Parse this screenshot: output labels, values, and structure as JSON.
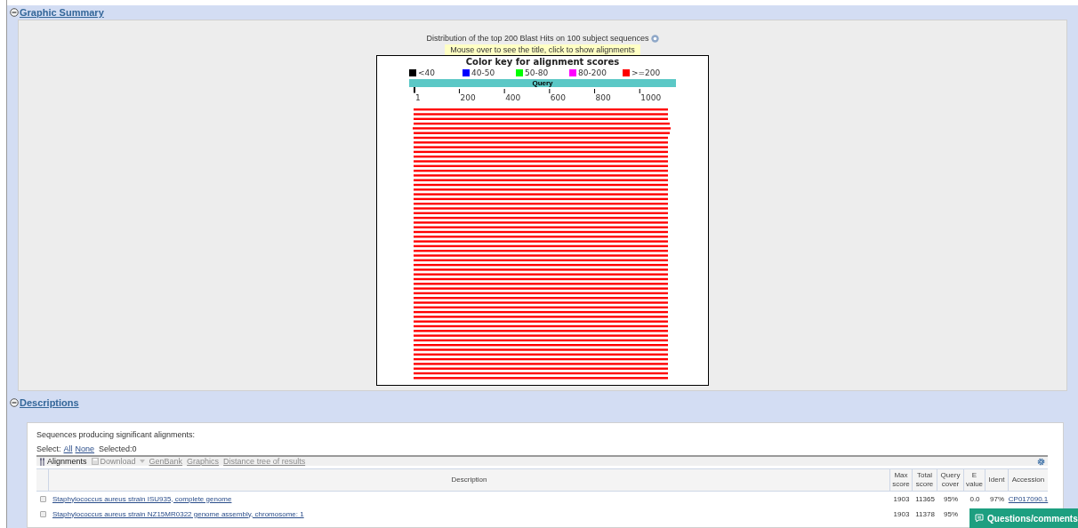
{
  "sections": [
    {
      "title": "Graphic Summary",
      "expanded": true
    },
    {
      "title": "Descriptions",
      "expanded": true
    }
  ],
  "graphic": {
    "title": "Distribution of the top 200 Blast Hits on 100 subject sequences",
    "hint": "Mouse over to see the title, click to show alignments",
    "key_title": "Color key for alignment scores",
    "color_key": [
      {
        "label": "<40",
        "color": "#000000"
      },
      {
        "label": "40-50",
        "color": "#0000ff"
      },
      {
        "label": "50-80",
        "color": "#00ff00"
      },
      {
        "label": "80-200",
        "color": "#ff00ff"
      },
      {
        "label": ">=200",
        "color": "#ff0000"
      }
    ],
    "query_label": "Query",
    "axis_ticks": [
      "1",
      "200",
      "400",
      "600",
      "800",
      "1000"
    ]
  },
  "descriptions": {
    "heading": "Sequences producing significant alignments:",
    "select_label": "Select:",
    "select_links": [
      "All",
      "None"
    ],
    "selected_count": "Selected:0",
    "toolbar": [
      {
        "label": "Alignments",
        "kind": "alignments",
        "disabled": false
      },
      {
        "label": "Download",
        "kind": "download",
        "disabled": true
      },
      {
        "label": "GenBank",
        "kind": "link",
        "disabled": true
      },
      {
        "label": "Graphics",
        "kind": "link",
        "disabled": true
      },
      {
        "label": "Distance tree of results",
        "kind": "link",
        "disabled": true
      }
    ],
    "columns": [
      "Description",
      "Max score",
      "Total score",
      "Query cover",
      "E value",
      "Ident",
      "Accession"
    ],
    "rows": [
      {
        "checked": false,
        "cells": [
          "Staphylococcus aureus strain ISU935, complete genome",
          "1903",
          "11365",
          "95%",
          "0.0",
          "97%",
          "CP017090.1"
        ]
      },
      {
        "checked": false,
        "cells": [
          "Staphylococcus aureus strain NZ15MR0322 genome assembly, chromosome: 1",
          "1903",
          "11378",
          "95%"
        ]
      }
    ]
  },
  "feedback_button": "Questions/comments"
}
